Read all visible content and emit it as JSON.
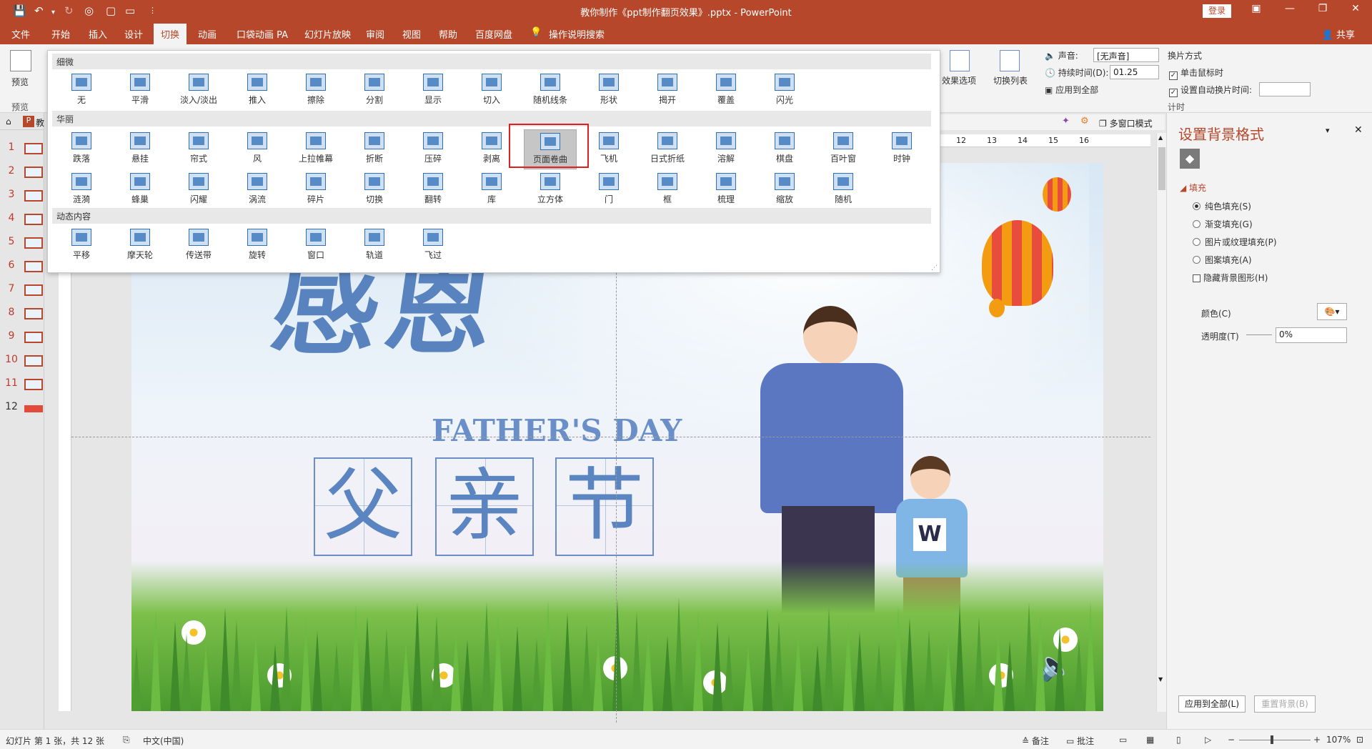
{
  "window": {
    "title": "教你制作《ppt制作翻页效果》.pptx - PowerPoint",
    "login": "登录"
  },
  "menu": {
    "tabs": [
      "文件",
      "开始",
      "插入",
      "设计",
      "切换",
      "动画",
      "口袋动画 PA",
      "幻灯片放映",
      "审阅",
      "视图",
      "帮助",
      "百度网盘",
      "操作说明搜索"
    ],
    "active": "切换",
    "share": "共享"
  },
  "ribbon": {
    "preview": "预览",
    "preview_group": "预览",
    "effect_options": "效果选项",
    "switch_list": "切换列表",
    "sound_label": "声音:",
    "sound_value": "[无声音]",
    "duration_label": "持续时间(D):",
    "duration_value": "01.25",
    "apply_all": "应用到全部",
    "switch_mode_title": "换片方式",
    "on_click": "单击鼠标时",
    "auto_after": "设置自动换片时间:",
    "auto_value": "",
    "timing_group": "计时"
  },
  "gallery": {
    "sections": [
      {
        "name": "细微",
        "items": [
          "无",
          "平滑",
          "淡入/淡出",
          "推入",
          "擦除",
          "分割",
          "显示",
          "切入",
          "随机线条",
          "形状",
          "揭开",
          "覆盖",
          "闪光"
        ]
      },
      {
        "name": "华丽",
        "items": [
          "跌落",
          "悬挂",
          "帘式",
          "风",
          "上拉帷幕",
          "折断",
          "压碎",
          "剥离",
          "页面卷曲",
          "飞机",
          "日式折纸",
          "溶解",
          "棋盘",
          "百叶窗",
          "时钟",
          "涟漪",
          "蜂巢",
          "闪耀",
          "涡流",
          "碎片",
          "切换",
          "翻转",
          "库",
          "立方体",
          "门",
          "框",
          "梳理",
          "缩放",
          "随机"
        ]
      },
      {
        "name": "动态内容",
        "items": [
          "平移",
          "摩天轮",
          "传送带",
          "旋转",
          "窗口",
          "轨道",
          "飞过"
        ]
      }
    ],
    "selected": "页面卷曲"
  },
  "view": {
    "multi_window": "多窗口模式",
    "ruler_ticks": [
      "12",
      "13",
      "14",
      "15",
      "16"
    ],
    "tab_label": "教"
  },
  "slides": {
    "numbers": [
      "1",
      "2",
      "3",
      "4",
      "5",
      "6",
      "7",
      "8",
      "9",
      "10",
      "11",
      "12"
    ]
  },
  "slide": {
    "title_cn": "感恩",
    "subtitle_en": "FATHER'S DAY",
    "chars": [
      "父",
      "亲",
      "节"
    ],
    "shirt_letter": "W"
  },
  "format_pane": {
    "title": "设置背景格式",
    "fill_section": "填充",
    "options": [
      "纯色填充(S)",
      "渐变填充(G)",
      "图片或纹理填充(P)",
      "图案填充(A)"
    ],
    "hide_bg": "隐藏背景图形(H)",
    "color_label": "颜色(C)",
    "transparency_label": "透明度(T)",
    "transparency_value": "0%",
    "apply_all": "应用到全部(L)",
    "reset": "重置背景(B)"
  },
  "status": {
    "slide_info": "幻灯片 第 1 张，共 12 张",
    "language": "中文(中国)",
    "notes": "备注",
    "comments": "批注",
    "zoom": "107%"
  },
  "colors": {
    "accent": "#b7472a",
    "selection": "#e02020",
    "slide_blue": "#4a78b8"
  }
}
